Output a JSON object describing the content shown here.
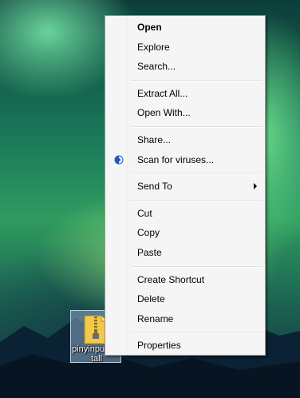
{
  "desktop": {
    "icon": {
      "label": "pinyinput-install",
      "icon_name": "zip-folder-icon"
    }
  },
  "context_menu": {
    "groups": [
      [
        {
          "label": "Open",
          "bold": true
        },
        {
          "label": "Explore"
        },
        {
          "label": "Search..."
        }
      ],
      [
        {
          "label": "Extract All..."
        },
        {
          "label": "Open With..."
        }
      ],
      [
        {
          "label": "Share..."
        },
        {
          "label": "Scan for viruses...",
          "icon": "antivirus-shield-icon"
        }
      ],
      [
        {
          "label": "Send To",
          "submenu": true
        }
      ],
      [
        {
          "label": "Cut"
        },
        {
          "label": "Copy"
        },
        {
          "label": "Paste"
        }
      ],
      [
        {
          "label": "Create Shortcut"
        },
        {
          "label": "Delete"
        },
        {
          "label": "Rename"
        }
      ],
      [
        {
          "label": "Properties"
        }
      ]
    ]
  },
  "colors": {
    "menu_background": "#f5f5f5",
    "menu_border": "#979797",
    "icon_selection": "#8caac8"
  }
}
